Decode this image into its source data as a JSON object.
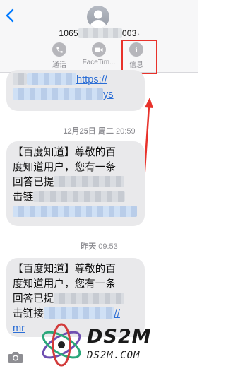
{
  "header": {
    "number_prefix": "1065",
    "number_suffix": "003",
    "actions": [
      {
        "label": "通话",
        "icon": "phone-icon"
      },
      {
        "label": "FaceTim...",
        "icon": "video-camera-icon"
      },
      {
        "label": "信息",
        "icon": "info-icon"
      }
    ]
  },
  "messages": [
    {
      "lines": [
        {
          "a": "",
          "b": "https://"
        },
        {
          "a": "",
          "b": "ys"
        }
      ]
    },
    {
      "lines": [
        {
          "a": "【百度知道】尊敬的百"
        },
        {
          "a": "度知道用户，您有一条"
        },
        {
          "a": "回答已提"
        },
        {
          "a": "击链"
        }
      ]
    },
    {
      "lines": [
        {
          "a": "【百度知道】尊敬的百"
        },
        {
          "a": "度知道用户，您有一条"
        },
        {
          "a": "回答已提"
        },
        {
          "a": "击链接",
          "b": "//"
        },
        {
          "a": "mr"
        }
      ]
    }
  ],
  "timestamps": [
    {
      "date": "12月25日 周二",
      "time": "20:59"
    },
    {
      "date": "昨天",
      "time": "09:53"
    }
  ],
  "colors": {
    "accent": "#007aff",
    "highlight": "#e8322b",
    "bubble": "#e9e9eb",
    "link": "#2b6ed6"
  },
  "watermark": {
    "title": "DS2M",
    "domain": "DS2M.COM"
  }
}
